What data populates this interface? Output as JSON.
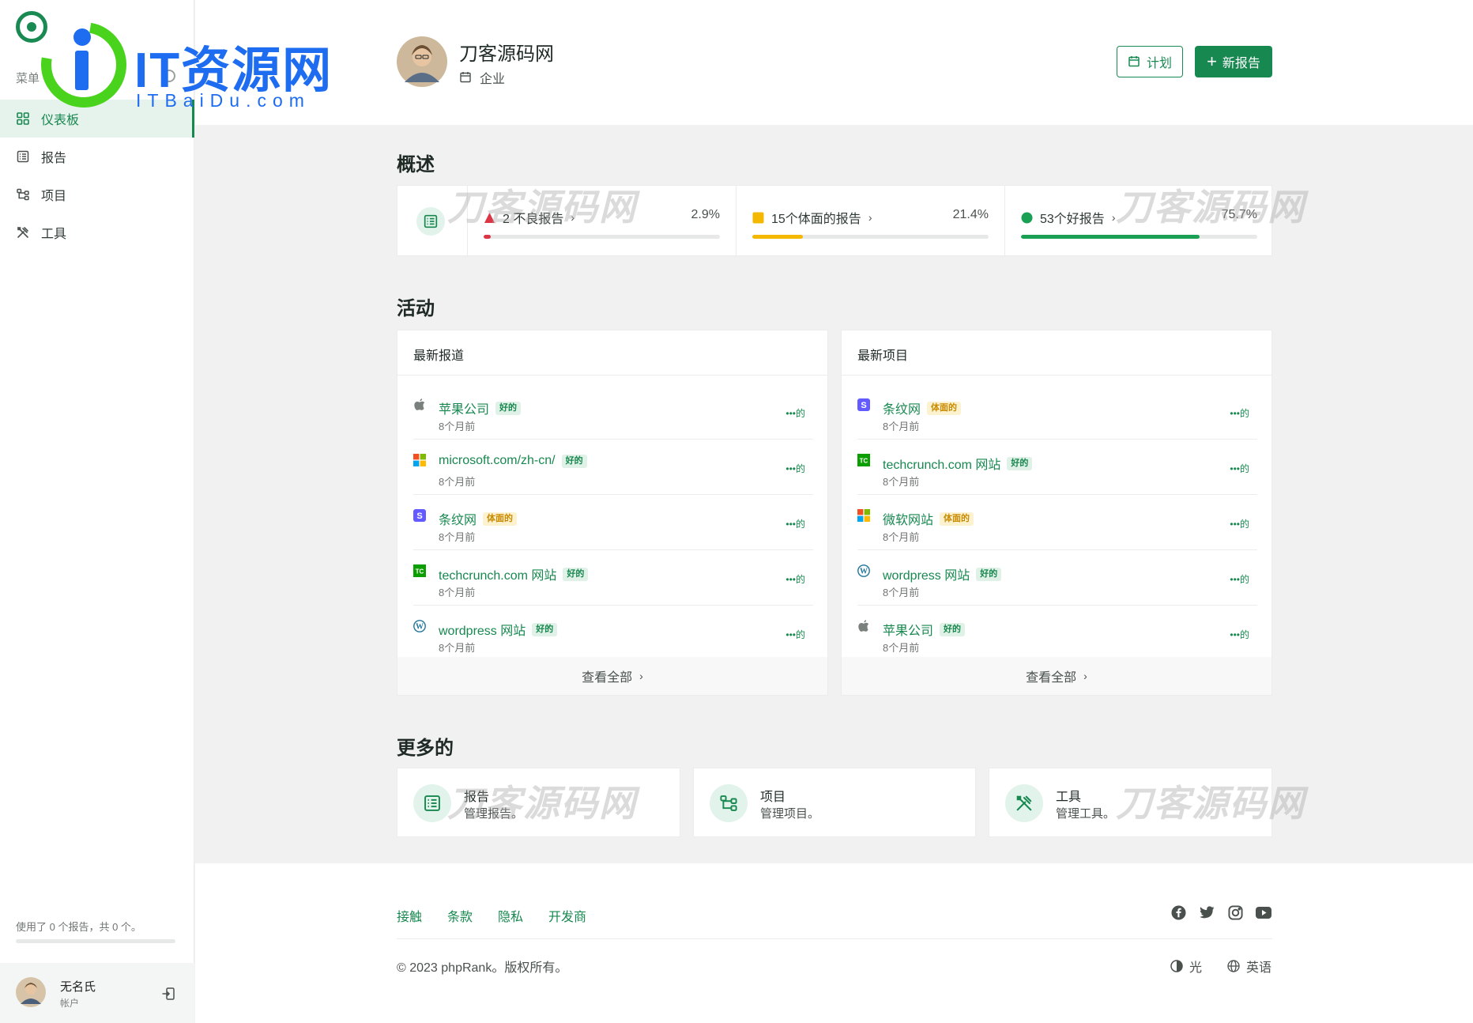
{
  "sidebar": {
    "menu_label": "菜单",
    "items": [
      {
        "label": "仪表板",
        "icon": "grid-icon",
        "active": true
      },
      {
        "label": "报告",
        "icon": "list-icon",
        "active": false
      },
      {
        "label": "项目",
        "icon": "project-tree-icon",
        "active": false
      },
      {
        "label": "工具",
        "icon": "tools-icon",
        "active": false
      }
    ],
    "usage_text": "使用了 0 个报告，共 0 个。",
    "usage_fraction": 0,
    "user": {
      "name": "无名氏",
      "role": "帐户"
    }
  },
  "watermark": {
    "logo_title": "IT资源网",
    "logo_subtitle": "ITBaiDu.com",
    "overlay_text": "刀客源码网"
  },
  "header": {
    "org_name": "刀客源码网",
    "org_type": "企业",
    "plan_label": "计划",
    "new_report_label": "新报告"
  },
  "overview": {
    "title": "概述",
    "stats": [
      {
        "label": "2 不良报告",
        "percent_text": "2.9%",
        "fraction": 0.029,
        "color": "#dc3545",
        "marker": "triangle"
      },
      {
        "label": "15个体面的报告",
        "percent_text": "21.4%",
        "fraction": 0.214,
        "color": "#f5b800",
        "marker": "square"
      },
      {
        "label": "53个好报告",
        "percent_text": "75.7%",
        "fraction": 0.757,
        "color": "#1aa055",
        "marker": "circle"
      }
    ]
  },
  "activity": {
    "title": "活动",
    "latest_reports": {
      "title": "最新报道",
      "footer": "查看全部",
      "rows": [
        {
          "name": "苹果公司",
          "badge": "好的",
          "badge_type": "good",
          "time": "8个月前",
          "brand": "apple-icon",
          "menu": "•••的"
        },
        {
          "name": "microsoft.com/zh-cn/",
          "badge": "好的",
          "badge_type": "good",
          "time": "8个月前",
          "brand": "microsoft-icon",
          "menu": "•••的"
        },
        {
          "name": "条纹网",
          "badge": "体面的",
          "badge_type": "ok",
          "time": "8个月前",
          "brand": "stripe-icon",
          "menu": "•••的"
        },
        {
          "name": "techcrunch.com 网站",
          "badge": "好的",
          "badge_type": "good",
          "time": "8个月前",
          "brand": "techcrunch-icon",
          "menu": "•••的"
        },
        {
          "name": "wordpress 网站",
          "badge": "好的",
          "badge_type": "good",
          "time": "8个月前",
          "brand": "wordpress-icon",
          "menu": "•••的"
        }
      ]
    },
    "latest_projects": {
      "title": "最新项目",
      "footer": "查看全部",
      "rows": [
        {
          "name": "条纹网",
          "badge": "体面的",
          "badge_type": "ok",
          "time": "8个月前",
          "brand": "stripe-icon",
          "menu": "•••的"
        },
        {
          "name": "techcrunch.com 网站",
          "badge": "好的",
          "badge_type": "good",
          "time": "8个月前",
          "brand": "techcrunch-icon",
          "menu": "•••的"
        },
        {
          "name": "微软网站",
          "badge": "体面的",
          "badge_type": "ok",
          "time": "8个月前",
          "brand": "microsoft-icon",
          "menu": "•••的"
        },
        {
          "name": "wordpress 网站",
          "badge": "好的",
          "badge_type": "good",
          "time": "8个月前",
          "brand": "wordpress-icon",
          "menu": "•••的"
        },
        {
          "name": "苹果公司",
          "badge": "好的",
          "badge_type": "good",
          "time": "8个月前",
          "brand": "apple-icon",
          "menu": "•••的"
        }
      ]
    }
  },
  "more": {
    "title": "更多的",
    "cards": [
      {
        "title": "报告",
        "desc": "管理报告。",
        "icon": "list-icon"
      },
      {
        "title": "项目",
        "desc": "管理项目。",
        "icon": "project-tree-icon"
      },
      {
        "title": "工具",
        "desc": "管理工具。",
        "icon": "tools-icon"
      }
    ]
  },
  "footer": {
    "links": [
      "接触",
      "条款",
      "隐私",
      "开发商"
    ],
    "social": [
      "facebook-icon",
      "twitter-icon",
      "instagram-icon",
      "youtube-icon"
    ],
    "copyright": "© 2023 phpRank。版权所有。",
    "theme_label": "光",
    "language_label": "英语"
  },
  "colors": {
    "accent": "#17884f",
    "accent_light": "#e1f3ea",
    "bad": "#dc3545",
    "decent": "#f5b800",
    "good": "#1aa055"
  }
}
